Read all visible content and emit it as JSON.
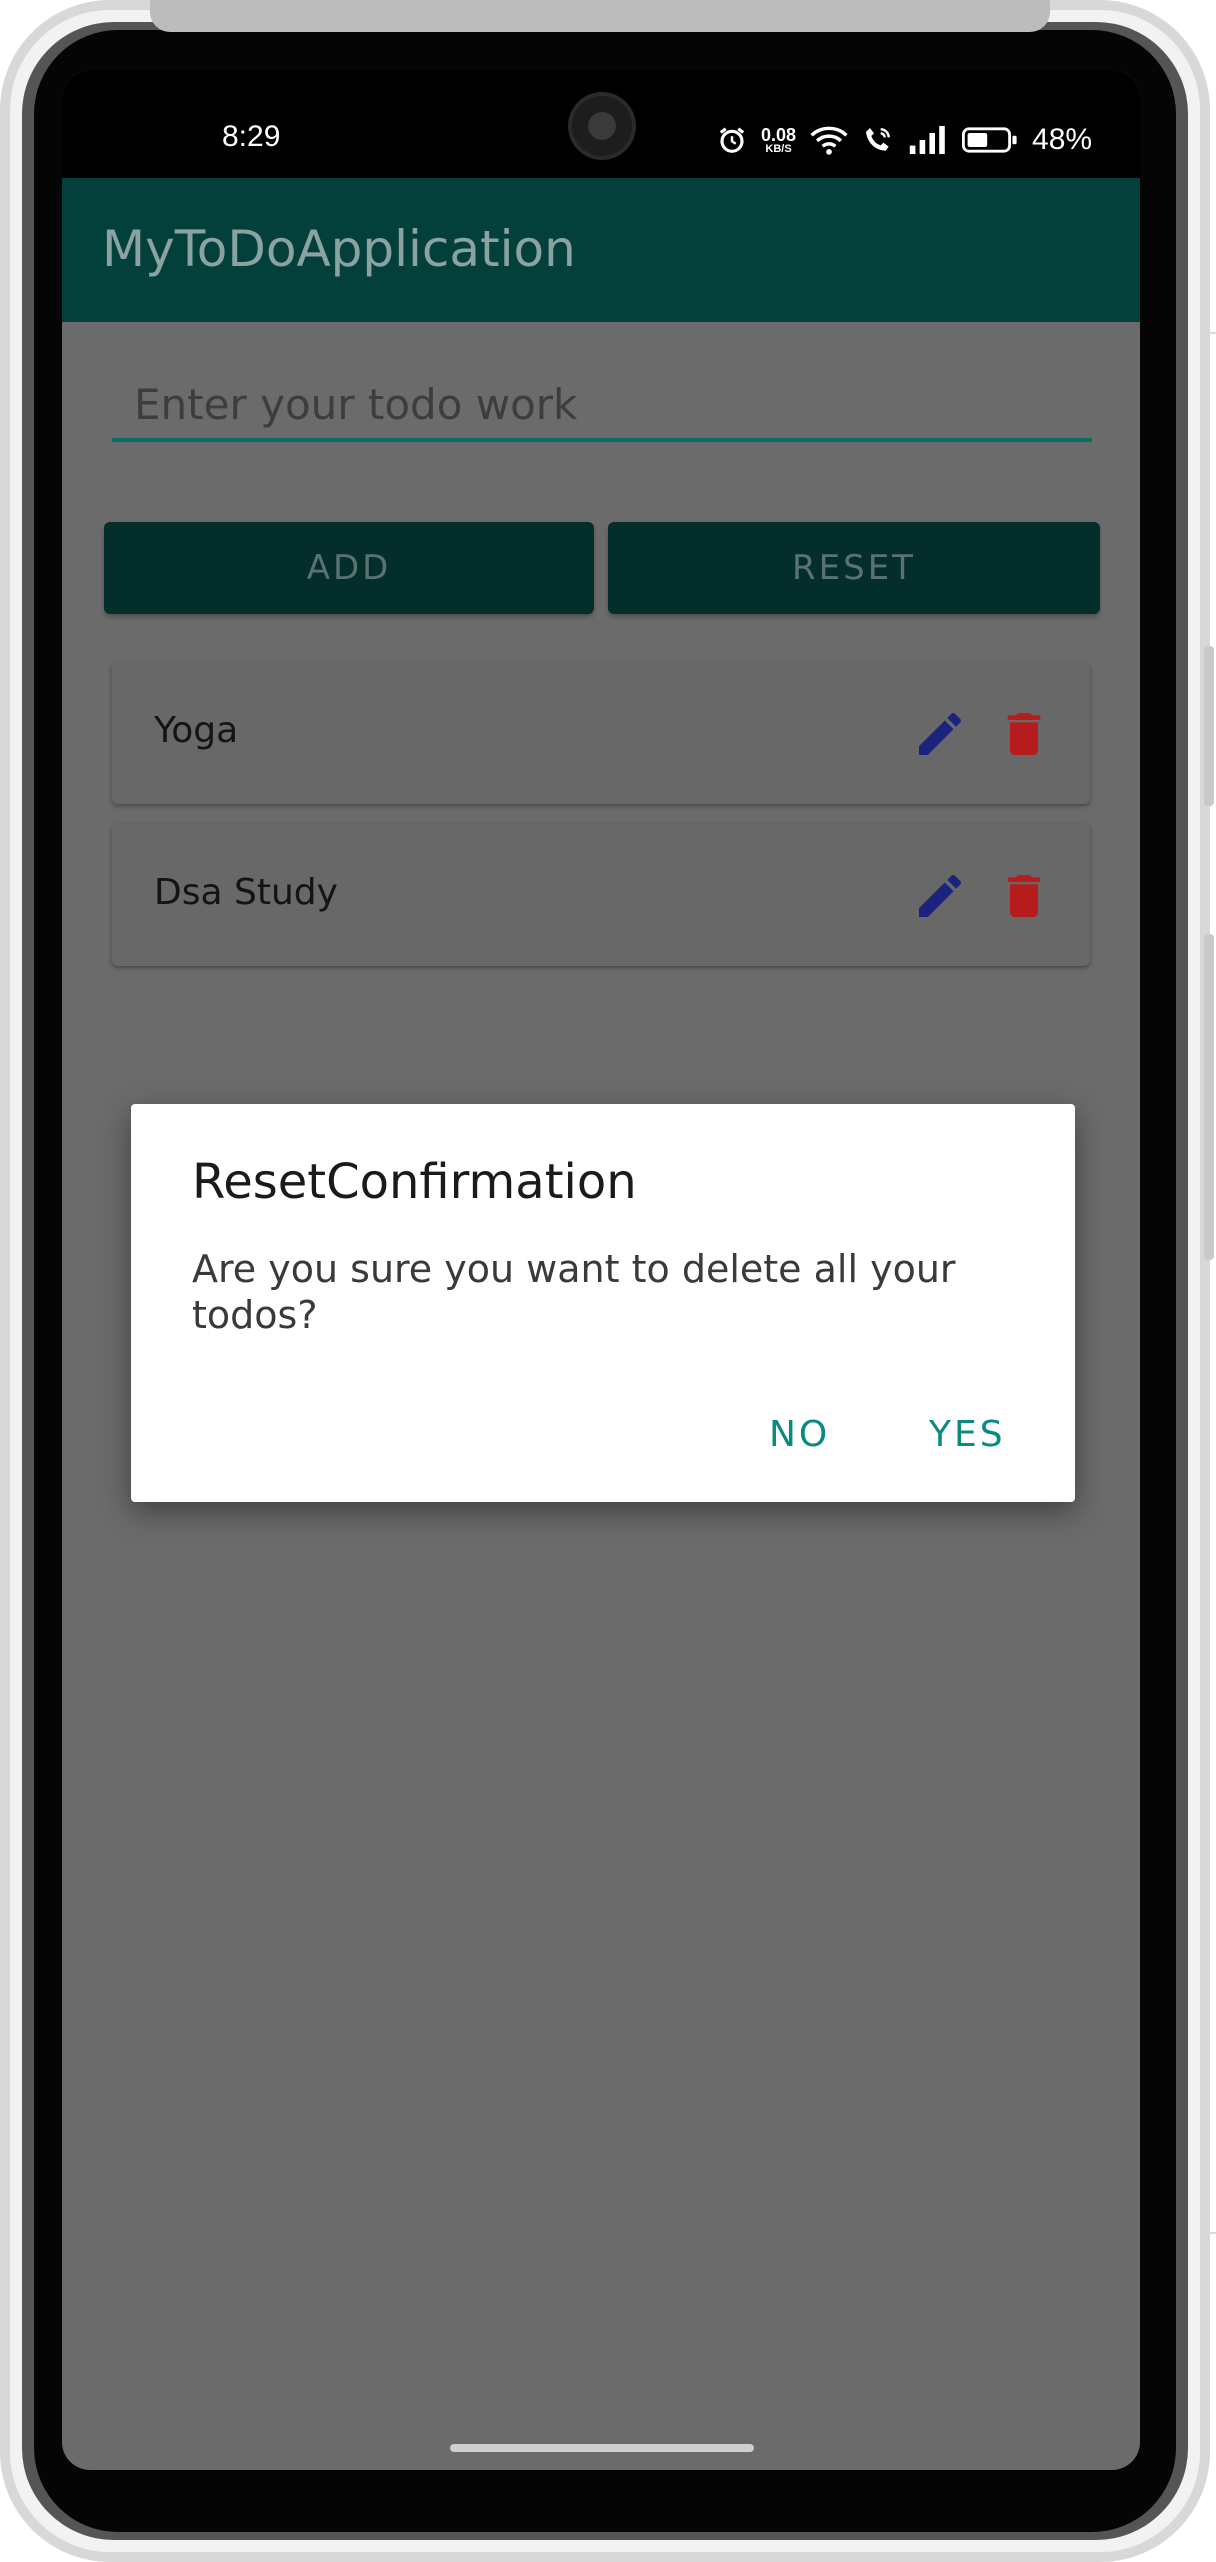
{
  "status_bar": {
    "time": "8:29",
    "net_speed_value": "0.08",
    "net_speed_unit": "KB/S",
    "battery_percent": "48%"
  },
  "app_bar": {
    "title": "MyToDoApplication"
  },
  "input": {
    "placeholder": "Enter your todo work",
    "value": ""
  },
  "buttons": {
    "add_label": "ADD",
    "reset_label": "RESET"
  },
  "todos": [
    {
      "text": "Yoga"
    },
    {
      "text": "Dsa Study"
    }
  ],
  "dialog": {
    "title": "ResetConfirmation",
    "message": "Are you sure you want to delete all your todos?",
    "no_label": "NO",
    "yes_label": "YES"
  },
  "colors": {
    "app_bar": "#03403c",
    "accent": "#0a8a80",
    "edit_icon": "#1a237e",
    "delete_icon": "#b71c1c",
    "scrim": "#6b6b6b"
  },
  "icons": {
    "alarm": "alarm-icon",
    "wifi": "wifi-icon",
    "call": "wifi-calling-icon",
    "signal": "signal-bars-icon",
    "battery": "battery-icon",
    "edit": "pencil-icon",
    "delete": "trash-icon"
  }
}
